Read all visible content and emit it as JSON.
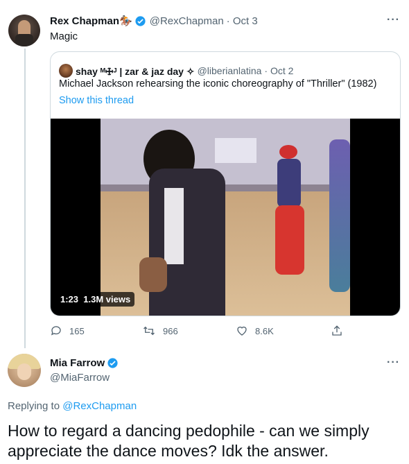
{
  "tweet1": {
    "name": "Rex Chapman🏇🏼",
    "handle": "@RexChapman",
    "date": "· Oct 3",
    "text": "Magic"
  },
  "quote": {
    "name": "shay ᴹ🜊ᴶ | zar & jaz day ✧",
    "handle": "@liberianlatina",
    "date": "· Oct 2",
    "text": "Michael Jackson rehearsing the iconic choreography of \"Thriller\" (1982)",
    "thread_link": "Show this thread",
    "video_time": "1:23",
    "video_views": "1.3M views"
  },
  "actions": {
    "reply_count": "165",
    "retweet_count": "966",
    "like_count": "8.6K"
  },
  "tweet2": {
    "name": "Mia Farrow",
    "handle": "@MiaFarrow",
    "replying_prefix": "Replying to ",
    "replying_to": "@RexChapman",
    "text": "How to regard a dancing pedophile  - can we simply appreciate the dance moves? Idk the answer."
  },
  "colors": {
    "accent": "#1d9bf0",
    "muted": "#536471",
    "border": "#cfd9de"
  }
}
